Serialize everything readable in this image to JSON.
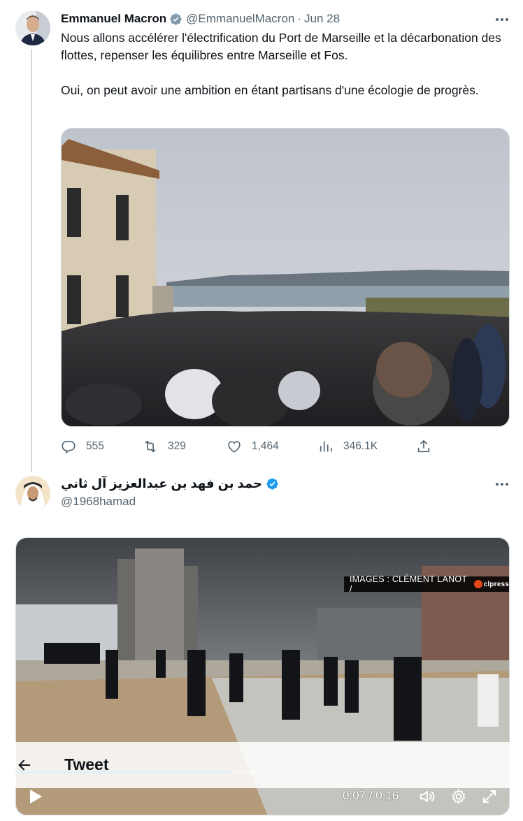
{
  "tweet1": {
    "author_name": "Emmanuel Macron",
    "handle": "@EmmanuelMacron",
    "separator": "·",
    "date": "Jun 28",
    "paragraphs": [
      "Nous allons accélérer l'électrification du Port de Marseille et la décarbonation des flottes, repenser les équilibres entre Marseille et Fos.",
      "Oui, on peut avoir une ambition en étant partisans d'une écologie de progrès."
    ],
    "media_description": "",
    "stats": {
      "replies": "555",
      "retweets": "329",
      "likes": "1,464",
      "views": "346.1K"
    }
  },
  "tweet2": {
    "author_name": "حمد بن فهد بن عبدالعزيز آل ثاني",
    "handle": "@1968hamad",
    "video": {
      "overlay_credit": "IMAGES : CLÉMENT LANOT  /",
      "overlay_brand": "clpress",
      "current_time": "0:07",
      "separator": "/",
      "duration": "0:16",
      "progress": 0.4375
    }
  },
  "sticky_header": {
    "title": "Tweet"
  },
  "colors": {
    "text": "#0f1419",
    "muted": "#536471",
    "verified": "#1d9bf0",
    "border": "#cfd9de"
  },
  "icons": {
    "more": "more-horizontal-icon",
    "verified": "verified-badge-icon",
    "reply": "reply-icon",
    "retweet": "retweet-icon",
    "like": "heart-icon",
    "views": "views-chart-icon",
    "share": "share-icon",
    "back": "back-arrow-icon",
    "play": "play-icon",
    "volume": "volume-icon",
    "settings": "settings-gear-icon",
    "fullscreen": "fullscreen-icon"
  }
}
